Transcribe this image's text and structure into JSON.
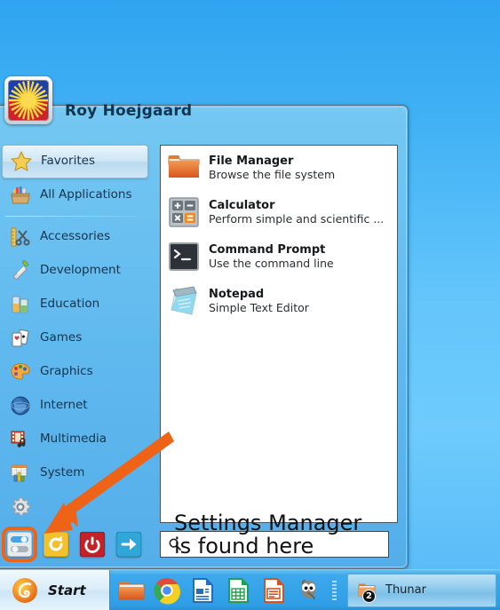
{
  "desktop": {
    "background_top": "#2fa4f0",
    "background_mid": "#6ecbfc"
  },
  "menu": {
    "user_name": "Roy Hoejgaard",
    "avatar_icon": "philippine-sun-flag-icon",
    "sidebar": {
      "top_items": [
        {
          "label": "Favorites",
          "icon": "star-icon",
          "selected": true
        },
        {
          "label": "All Applications",
          "icon": "toolbox-icon",
          "selected": false
        }
      ],
      "categories": [
        {
          "label": "Accessories",
          "icon": "ruler-scissors-icon"
        },
        {
          "label": "Development",
          "icon": "trowel-icon"
        },
        {
          "label": "Education",
          "icon": "beakers-icon"
        },
        {
          "label": "Games",
          "icon": "playing-cards-icon"
        },
        {
          "label": "Graphics",
          "icon": "paint-palette-icon"
        },
        {
          "label": "Internet",
          "icon": "globe-icon"
        },
        {
          "label": "Multimedia",
          "icon": "film-music-icon"
        },
        {
          "label": "System",
          "icon": "gear-icon"
        }
      ]
    },
    "applications": [
      {
        "name": "File Manager",
        "description": "Browse the file system",
        "icon": "folder-icon"
      },
      {
        "name": "Calculator",
        "description": "Perform simple and scientific ...",
        "icon": "calculator-icon"
      },
      {
        "name": "Command Prompt",
        "description": "Use the command line",
        "icon": "terminal-icon"
      },
      {
        "name": "Notepad",
        "description": "Simple Text Editor",
        "icon": "notepad-icon"
      }
    ],
    "actions": [
      {
        "name": "Settings Manager",
        "icon": "settings-sliders-icon",
        "highlighted": true
      },
      {
        "name": "Restart",
        "icon": "restart-icon",
        "highlighted": false
      },
      {
        "name": "Shut Down",
        "icon": "power-icon",
        "highlighted": false
      },
      {
        "name": "Log Out",
        "icon": "logout-arrow-icon",
        "highlighted": false
      }
    ],
    "search": {
      "value": "",
      "placeholder": "",
      "icon": "search-icon"
    }
  },
  "annotation": {
    "text_line1": "Settings Manager",
    "text_line2": "is found here",
    "arrow_color": "#ef6316",
    "highlight_color": "#ef6316"
  },
  "taskbar": {
    "start_label": "Start",
    "start_icon": "xfce-mouse-icon",
    "launchers": [
      {
        "name": "File Manager",
        "icon": "folder-icon"
      },
      {
        "name": "Google Chrome",
        "icon": "chrome-icon"
      },
      {
        "name": "LibreOffice Writer",
        "icon": "writer-icon"
      },
      {
        "name": "LibreOffice Calc",
        "icon": "calc-icon"
      },
      {
        "name": "LibreOffice Impress",
        "icon": "impress-icon"
      },
      {
        "name": "GIMP",
        "icon": "gimp-wilber-icon"
      }
    ],
    "tasks": [
      {
        "label": "Thunar",
        "icon": "folder-icon",
        "badge": "2"
      }
    ]
  }
}
